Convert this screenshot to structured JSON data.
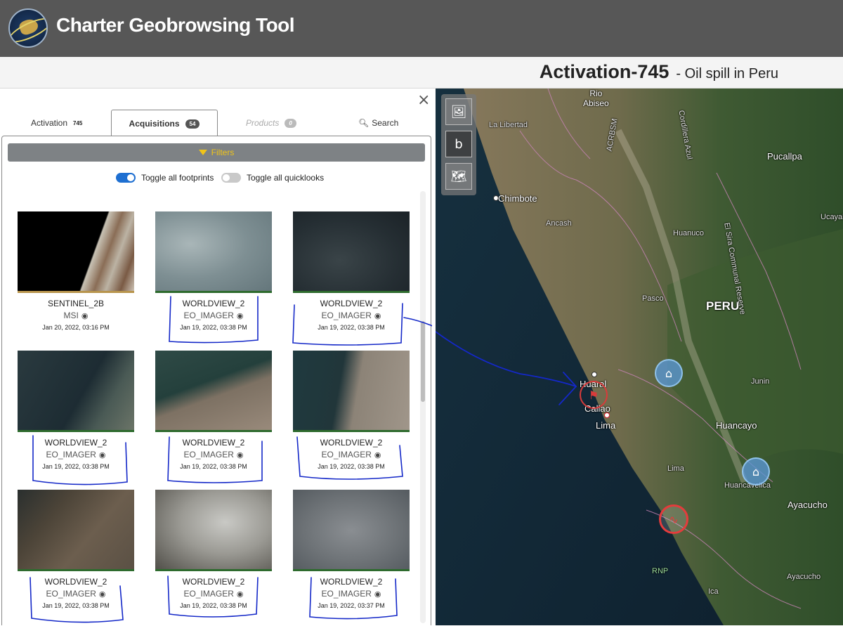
{
  "header": {
    "app_title": "Charter Geobrowsing Tool",
    "activation_title": "Activation-745",
    "activation_subtitle": "- Oil spill in Peru"
  },
  "panel": {
    "close_label": "×",
    "tabs": [
      {
        "label": "Activation",
        "badge": "745",
        "state": "normal"
      },
      {
        "label": "Acquisitions",
        "badge": "54",
        "state": "active"
      },
      {
        "label": "Products",
        "badge": "0",
        "state": "disabled"
      },
      {
        "label": "Search",
        "icon": "search-icon",
        "state": "normal"
      }
    ],
    "filters_label": "Filters",
    "toggle_footprints_label": "Toggle all footprints",
    "toggle_footprints_on": true,
    "toggle_quicklooks_label": "Toggle all quicklooks",
    "toggle_quicklooks_on": false,
    "cards": [
      {
        "satellite": "SENTINEL_2B",
        "sensor": "MSI",
        "date": "Jan 20, 2022, 03:16 PM",
        "eye_icon": "eye-icon"
      },
      {
        "satellite": "WORLDVIEW_2",
        "sensor": "EO_IMAGER",
        "date": "Jan 19, 2022, 03:38 PM",
        "eye_icon": "eye-icon"
      },
      {
        "satellite": "WORLDVIEW_2",
        "sensor": "EO_IMAGER",
        "date": "Jan 19, 2022, 03:38 PM",
        "eye_icon": "eye-icon"
      },
      {
        "satellite": "WORLDVIEW_2",
        "sensor": "EO_IMAGER",
        "date": "Jan 19, 2022, 03:38 PM",
        "eye_icon": "eye-icon"
      },
      {
        "satellite": "WORLDVIEW_2",
        "sensor": "EO_IMAGER",
        "date": "Jan 19, 2022, 03:38 PM",
        "eye_icon": "eye-icon"
      },
      {
        "satellite": "WORLDVIEW_2",
        "sensor": "EO_IMAGER",
        "date": "Jan 19, 2022, 03:38 PM",
        "eye_icon": "eye-icon"
      },
      {
        "satellite": "WORLDVIEW_2",
        "sensor": "EO_IMAGER",
        "date": "Jan 19, 2022, 03:38 PM",
        "eye_icon": "eye-icon"
      },
      {
        "satellite": "WORLDVIEW_2",
        "sensor": "EO_IMAGER",
        "date": "Jan 19, 2022, 03:38 PM",
        "eye_icon": "eye-icon"
      },
      {
        "satellite": "WORLDVIEW_2",
        "sensor": "EO_IMAGER",
        "date": "Jan 19, 2022, 03:37 PM",
        "eye_icon": "eye-icon"
      }
    ]
  },
  "map": {
    "tools": [
      "map-image-icon",
      "bing-icon",
      "map-search-icon"
    ],
    "labels": {
      "rio_abiseo": "Rio\nAbiseo",
      "la_libertad": "La Libertad",
      "acrbsm": "ACRBSM",
      "cordillera": "Cordillera Azul",
      "peru": "PERU",
      "pucallpa": "Pucallpa",
      "ucayali": "Ucayal",
      "chimbote": "Chimbote",
      "ancash": "Ancash",
      "huanuco": "Huanuco",
      "el_sira": "El Sira Communal Reserve",
      "pasco": "Pasco",
      "junin": "Junin",
      "huaral": "Huaral",
      "callao": "Callao",
      "lima_city": "Lima",
      "huancayo": "Huancayo",
      "lima_region": "Lima",
      "huancavelica": "Huancavelica",
      "ayacucho": "Ayacucho",
      "ayacucho2": "Ayacucho",
      "rnp": "RNP",
      "ica": "Ica"
    },
    "marker_icons": [
      "oil-spill-marker-icon",
      "flood-marker-icon",
      "flood-marker-icon",
      "earthquake-marker-icon"
    ]
  }
}
